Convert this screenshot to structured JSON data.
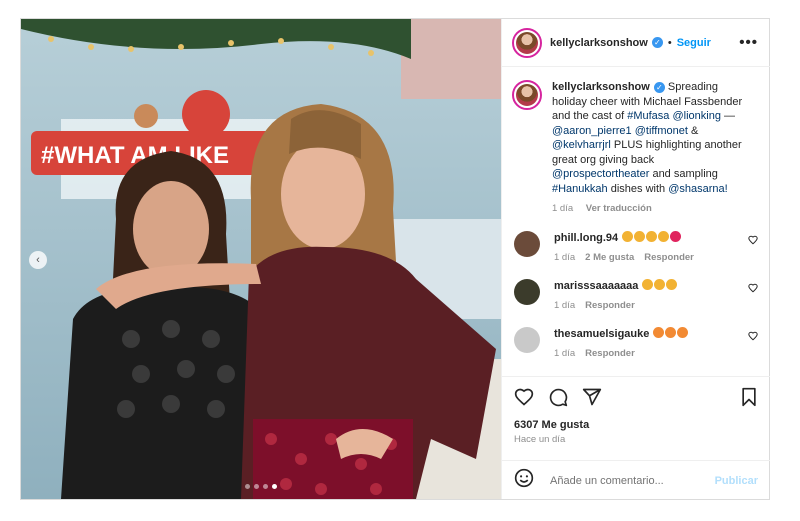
{
  "header": {
    "username": "kellyclarksonshow",
    "separator": "•",
    "follow_label": "Seguir",
    "more_label": "•••"
  },
  "photo": {
    "banner_text": "#WHAT AM LIKE",
    "prev_label": "‹",
    "carousel_dots": 4,
    "carousel_active": 3
  },
  "caption": {
    "username": "kellyclarksonshow",
    "segments": [
      {
        "t": " Spreading holiday cheer with Michael Fassbender and the cast of ",
        "tag": false
      },
      {
        "t": "#Mufasa",
        "tag": true
      },
      {
        "t": " ",
        "tag": false
      },
      {
        "t": "@lionking",
        "tag": true
      },
      {
        "t": " — ",
        "tag": false
      },
      {
        "t": "@aaron_pierre1",
        "tag": true
      },
      {
        "t": " ",
        "tag": false
      },
      {
        "t": "@tiffmonet",
        "tag": true
      },
      {
        "t": " & ",
        "tag": false
      },
      {
        "t": "@kelvharrjrl",
        "tag": true
      },
      {
        "t": " PLUS highlighting another great org giving back ",
        "tag": false
      },
      {
        "t": "@prospectortheater",
        "tag": true
      },
      {
        "t": " and sampling ",
        "tag": false
      },
      {
        "t": "#Hanukkah",
        "tag": true
      },
      {
        "t": " dishes with ",
        "tag": false
      },
      {
        "t": "@shasarna!",
        "tag": true
      }
    ],
    "time": "1 día",
    "translate_label": "Ver traducción"
  },
  "comments": [
    {
      "username": "phill.long.94",
      "emojis": [
        "#f2b233",
        "#f2b233",
        "#f2b233",
        "#f2b233",
        "#e0245e"
      ],
      "time": "1 día",
      "likes": "2 Me gusta",
      "reply": "Responder",
      "avatar_color": "#6b4b3a"
    },
    {
      "username": "marisssaaaaaaa",
      "emojis": [
        "#f2b233",
        "#f2b233",
        "#f2b233"
      ],
      "time": "1 día",
      "likes": "",
      "reply": "Responder",
      "avatar_color": "#3b3b2b"
    },
    {
      "username": "thesamuelsigauke",
      "emojis": [
        "#f28a33",
        "#f28a33",
        "#f28a33"
      ],
      "time": "1 día",
      "likes": "",
      "reply": "Responder",
      "avatar_color": "#c9c9c9"
    }
  ],
  "actions": {
    "likes_count": "6307 Me gusta",
    "time": "Hace un día",
    "icons": [
      "heart-icon",
      "comment-icon",
      "share-icon",
      "bookmark-icon"
    ]
  },
  "add_comment": {
    "placeholder": "Añade un comentario...",
    "publish_label": "Publicar"
  },
  "colors": {
    "accent": "#0095f6",
    "verified": "#3897f0",
    "muted": "#8e8e8e",
    "tag": "#00376b"
  }
}
